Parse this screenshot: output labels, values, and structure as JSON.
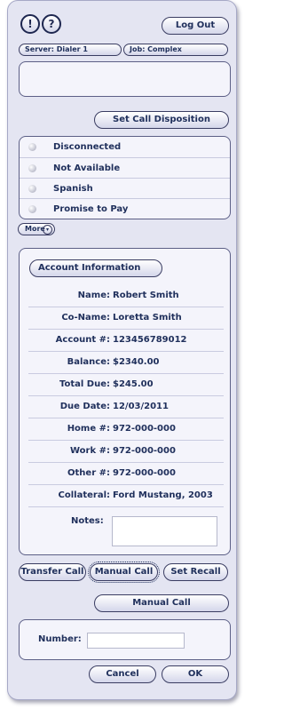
{
  "header": {
    "alert_icon": "!",
    "help_icon": "?",
    "logout_label": "Log Out",
    "server_label": "Server: Dialer 1",
    "job_label": "Job: Complex"
  },
  "disposition": {
    "button_label": "Set Call Disposition",
    "options": [
      "Disconnected",
      "Not Available",
      "Spanish",
      "Promise to Pay"
    ],
    "more_label": "More"
  },
  "account": {
    "title": "Account Information",
    "rows": [
      {
        "label": "Name:",
        "value": "Robert Smith"
      },
      {
        "label": "Co-Name:",
        "value": "Loretta Smith"
      },
      {
        "label": "Account #:",
        "value": "123456789012"
      },
      {
        "label": "Balance:",
        "value": "$2340.00"
      },
      {
        "label": "Total Due:",
        "value": "$245.00"
      },
      {
        "label": "Due Date:",
        "value": "12/03/2011"
      },
      {
        "label": "Home #:",
        "value": "972-000-000"
      },
      {
        "label": "Work #:",
        "value": "972-000-000"
      },
      {
        "label": "Other #:",
        "value": "972-000-000"
      },
      {
        "label": "Collateral:",
        "value": "Ford Mustang, 2003"
      }
    ],
    "notes_label": "Notes:",
    "notes_value": ""
  },
  "actions": {
    "transfer_label": "Transfer Call",
    "manual_label": "Manual Call",
    "recall_label": "Set Recall"
  },
  "manual_call": {
    "title": "Manual Call",
    "number_label": "Number:",
    "number_value": "",
    "cancel_label": "Cancel",
    "ok_label": "OK"
  }
}
